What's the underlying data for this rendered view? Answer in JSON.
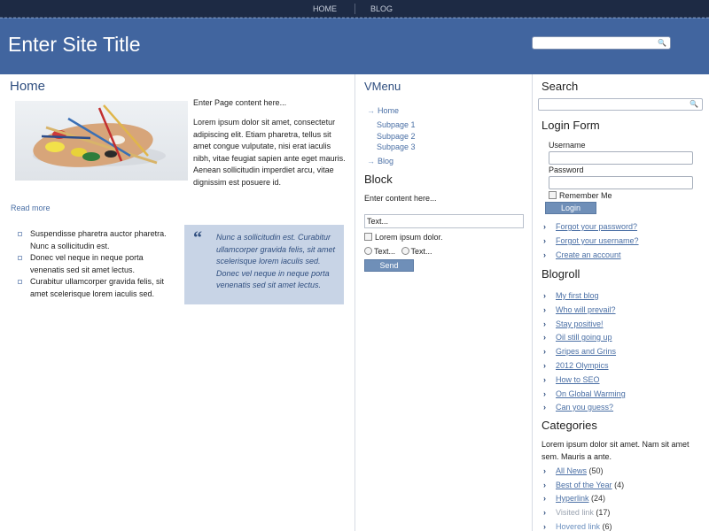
{
  "topnav": {
    "items": [
      "HOME",
      "BLOG"
    ]
  },
  "header": {
    "site_title": "Enter Site Title",
    "search_placeholder": ""
  },
  "main": {
    "title": "Home",
    "intro": "Enter Page content here...",
    "body": "Lorem ipsum dolor sit amet, consectetur adipiscing elit. Etiam pharetra, tellus sit amet congue vulputate, nisi erat iaculis nibh, vitae feugiat sapien ante eget mauris. Aenean sollicitudin imperdiet arcu, vitae dignissim est posuere id.",
    "read_more": "Read more",
    "bullets": [
      "Suspendisse pharetra auctor pharetra. Nunc a sollicitudin est.",
      "Donec vel neque in neque porta venenatis sed sit amet lectus.",
      "Curabitur ullamcorper gravida felis, sit amet scelerisque lorem iaculis sed."
    ],
    "quote": "Nunc a sollicitudin est. Curabitur ullamcorper gravida felis, sit amet scelerisque lorem iaculis sed. Donec vel neque in neque porta venenatis sed sit amet lectus."
  },
  "vmenu": {
    "title": "VMenu",
    "items": [
      "Home",
      "Subpage 1",
      "Subpage 2",
      "Subpage 3",
      "Blog"
    ]
  },
  "block": {
    "title": "Block",
    "text": "Enter content here...",
    "input_value": "Text...",
    "checkbox_label": "Lorem ipsum dolor.",
    "radio1": "Text...",
    "radio2": "Text...",
    "send": "Send"
  },
  "sidebar": {
    "search_title": "Search",
    "login_title": "Login Form",
    "username_label": "Username",
    "password_label": "Password",
    "remember_label": "Remember Me",
    "login_button": "Login",
    "login_links": [
      "Forgot your password?",
      "Forgot your username?",
      "Create an account"
    ],
    "blogroll_title": "Blogroll",
    "blogroll": [
      "My first blog",
      "Who will prevail?",
      "Stay positive!",
      "Oil still going up",
      "Gripes and Grins",
      "2012 Olympics",
      "How to SEO",
      "On Global Warming",
      "Can you guess?"
    ],
    "categories_title": "Categories",
    "categories_desc": "Lorem ipsum dolor sit amet. Nam sit amet sem. Mauris a ante.",
    "categories": [
      {
        "label": "All News",
        "count": "(50)"
      },
      {
        "label": "Best of the Year",
        "count": "(4)"
      },
      {
        "label": "Hyperlink",
        "count": "(24)"
      },
      {
        "label": "Visited link",
        "count": "(17)"
      },
      {
        "label": "Hovered link",
        "count": "(6)"
      }
    ]
  },
  "colors": {
    "header_bg": "#41659f",
    "topnav_bg": "#1d2a44",
    "title_blue": "#2f4e7f",
    "link_blue": "#4a6fa5",
    "quote_bg": "#c8d4e6"
  },
  "icons": {
    "search": "search-icon",
    "chevron": "chevron-right-icon"
  }
}
